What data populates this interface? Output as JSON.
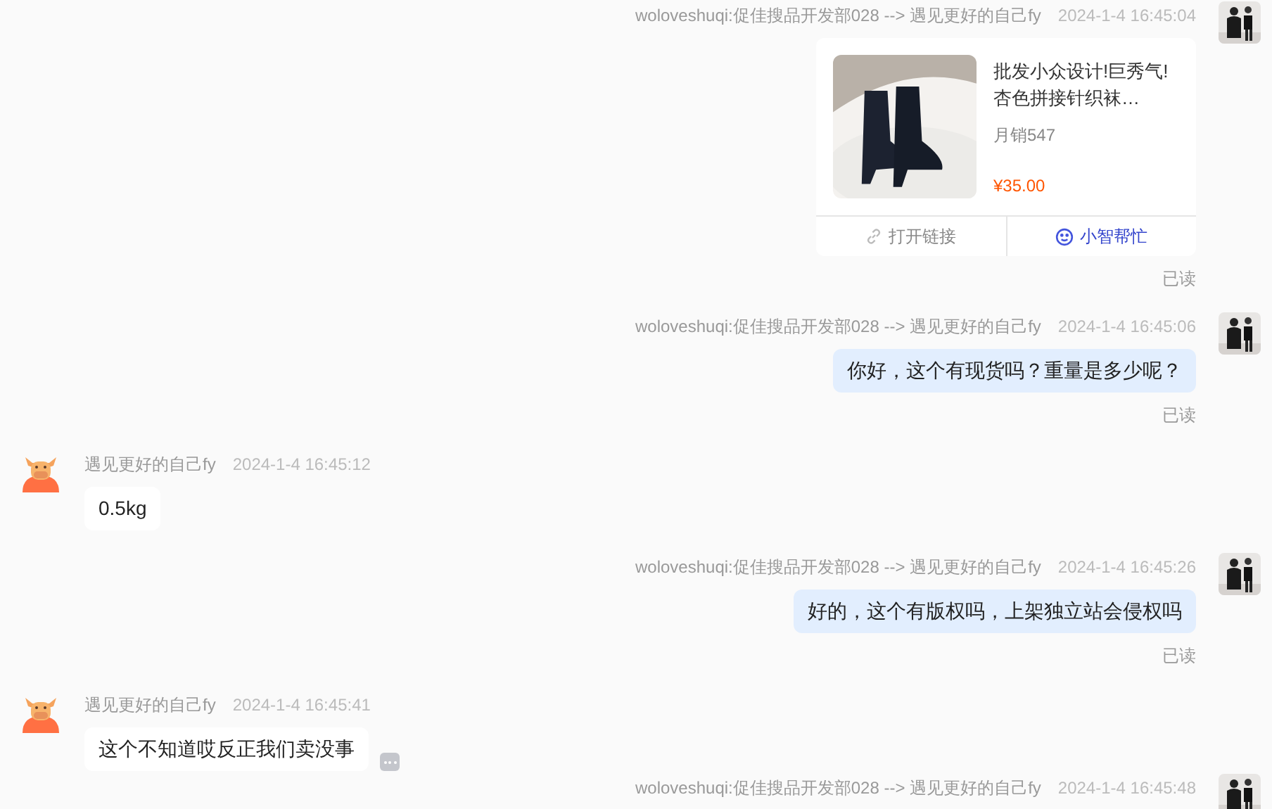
{
  "messages": [
    {
      "own": true,
      "kind": "product",
      "sender": "woloveshuqi:促佳搜品开发部028 --> 遇见更好的自己fy",
      "time": "2024-1-4 16:45:04",
      "product": {
        "title": "批发小众设计!巨秀气!杏色拼接针织袜…",
        "sales": "月销547",
        "price": "¥35.00",
        "actions": [
          {
            "label": "打开链接",
            "kind": "link"
          },
          {
            "label": "小智帮忙",
            "kind": "assistant"
          }
        ]
      },
      "status": "已读"
    },
    {
      "own": true,
      "kind": "text",
      "sender": "woloveshuqi:促佳搜品开发部028 --> 遇见更好的自己fy",
      "time": "2024-1-4 16:45:06",
      "text": "你好，这个有现货吗？重量是多少呢？",
      "status": "已读"
    },
    {
      "own": false,
      "kind": "text",
      "sender": "遇见更好的自己fy",
      "time": "2024-1-4 16:45:12",
      "text": "0.5kg"
    },
    {
      "own": true,
      "kind": "text",
      "sender": "woloveshuqi:促佳搜品开发部028 --> 遇见更好的自己fy",
      "time": "2024-1-4 16:45:26",
      "text": "好的，这个有版权吗，上架独立站会侵权吗",
      "status": "已读"
    },
    {
      "own": false,
      "kind": "text",
      "sender": "遇见更好的自己fy",
      "time": "2024-1-4 16:45:41",
      "text": "这个不知道哎反正我们卖没事",
      "more": true
    },
    {
      "own": true,
      "kind": "header",
      "sender": "woloveshuqi:促佳搜品开发部028 --> 遇见更好的自己fy",
      "time": "2024-1-4 16:45:48"
    }
  ]
}
